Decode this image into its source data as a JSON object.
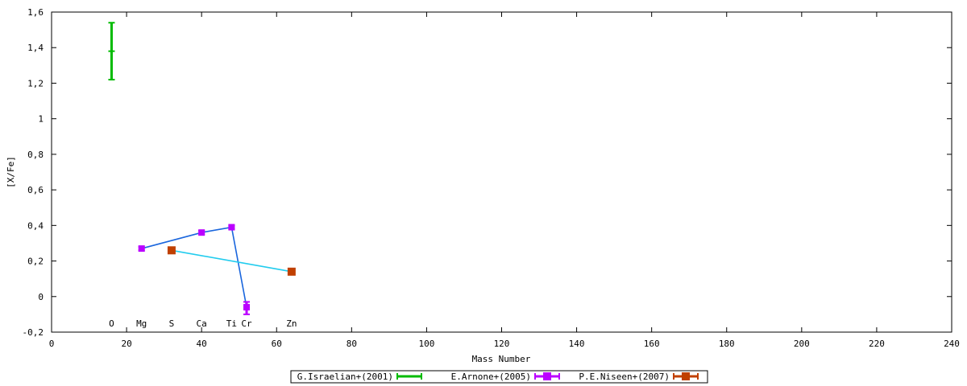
{
  "chart_data": {
    "type": "scatter",
    "xlabel": "Mass Number",
    "ylabel": "[X/Fe]",
    "xlim": [
      0,
      240
    ],
    "ylim": [
      -0.2,
      1.6
    ],
    "x_ticks": [
      0,
      20,
      40,
      60,
      80,
      100,
      120,
      140,
      160,
      180,
      200,
      220,
      240
    ],
    "x_tick_labels": [
      "0",
      "20",
      "40",
      "60",
      "80",
      "100",
      "120",
      "140",
      "160",
      "180",
      "200",
      "220",
      "240"
    ],
    "y_ticks": [
      -0.2,
      0,
      0.2,
      0.4,
      0.6,
      0.8,
      1,
      1.2,
      1.4,
      1.6
    ],
    "y_tick_labels": [
      "-0,2",
      "0",
      "0,2",
      "0,4",
      "0,6",
      "0,8",
      "1",
      "1,2",
      "1,4",
      "1,6"
    ],
    "grid": false,
    "legend_position": "bottom-center",
    "element_labels": [
      {
        "text": "O",
        "x": 16
      },
      {
        "text": "Mg",
        "x": 24
      },
      {
        "text": "S",
        "x": 32
      },
      {
        "text": "Ca",
        "x": 40
      },
      {
        "text": "Ti",
        "x": 48
      },
      {
        "text": "Cr",
        "x": 52
      },
      {
        "text": "Zn",
        "x": 64
      }
    ],
    "element_label_y": -0.15,
    "series": [
      {
        "name": "G.Israelian+(2001)",
        "color": "#00bb00",
        "line_color": "",
        "marker": "errorbar",
        "points": [
          {
            "x": 16,
            "y": 1.38,
            "ylow": 1.22,
            "yhigh": 1.54
          }
        ]
      },
      {
        "name": "E.Arnone+(2005)",
        "color": "#bb00ff",
        "line_color": "#1a66dd",
        "marker": "errorbar-box",
        "points": [
          {
            "x": 24,
            "y": 0.27,
            "ylow": 0.26,
            "yhigh": 0.28
          },
          {
            "x": 40,
            "y": 0.36,
            "ylow": 0.35,
            "yhigh": 0.37
          },
          {
            "x": 48,
            "y": 0.39,
            "ylow": 0.38,
            "yhigh": 0.4
          },
          {
            "x": 52,
            "y": -0.06,
            "ylow": -0.1,
            "yhigh": -0.03
          }
        ]
      },
      {
        "name": "P.E.Niseen+(2007)",
        "color": "#c04000",
        "line_color": "#22ccee",
        "marker": "box",
        "points": [
          {
            "x": 32,
            "y": 0.26,
            "ylow": 0.255,
            "yhigh": 0.265
          },
          {
            "x": 64,
            "y": 0.14,
            "ylow": 0.135,
            "yhigh": 0.145
          }
        ]
      }
    ]
  }
}
